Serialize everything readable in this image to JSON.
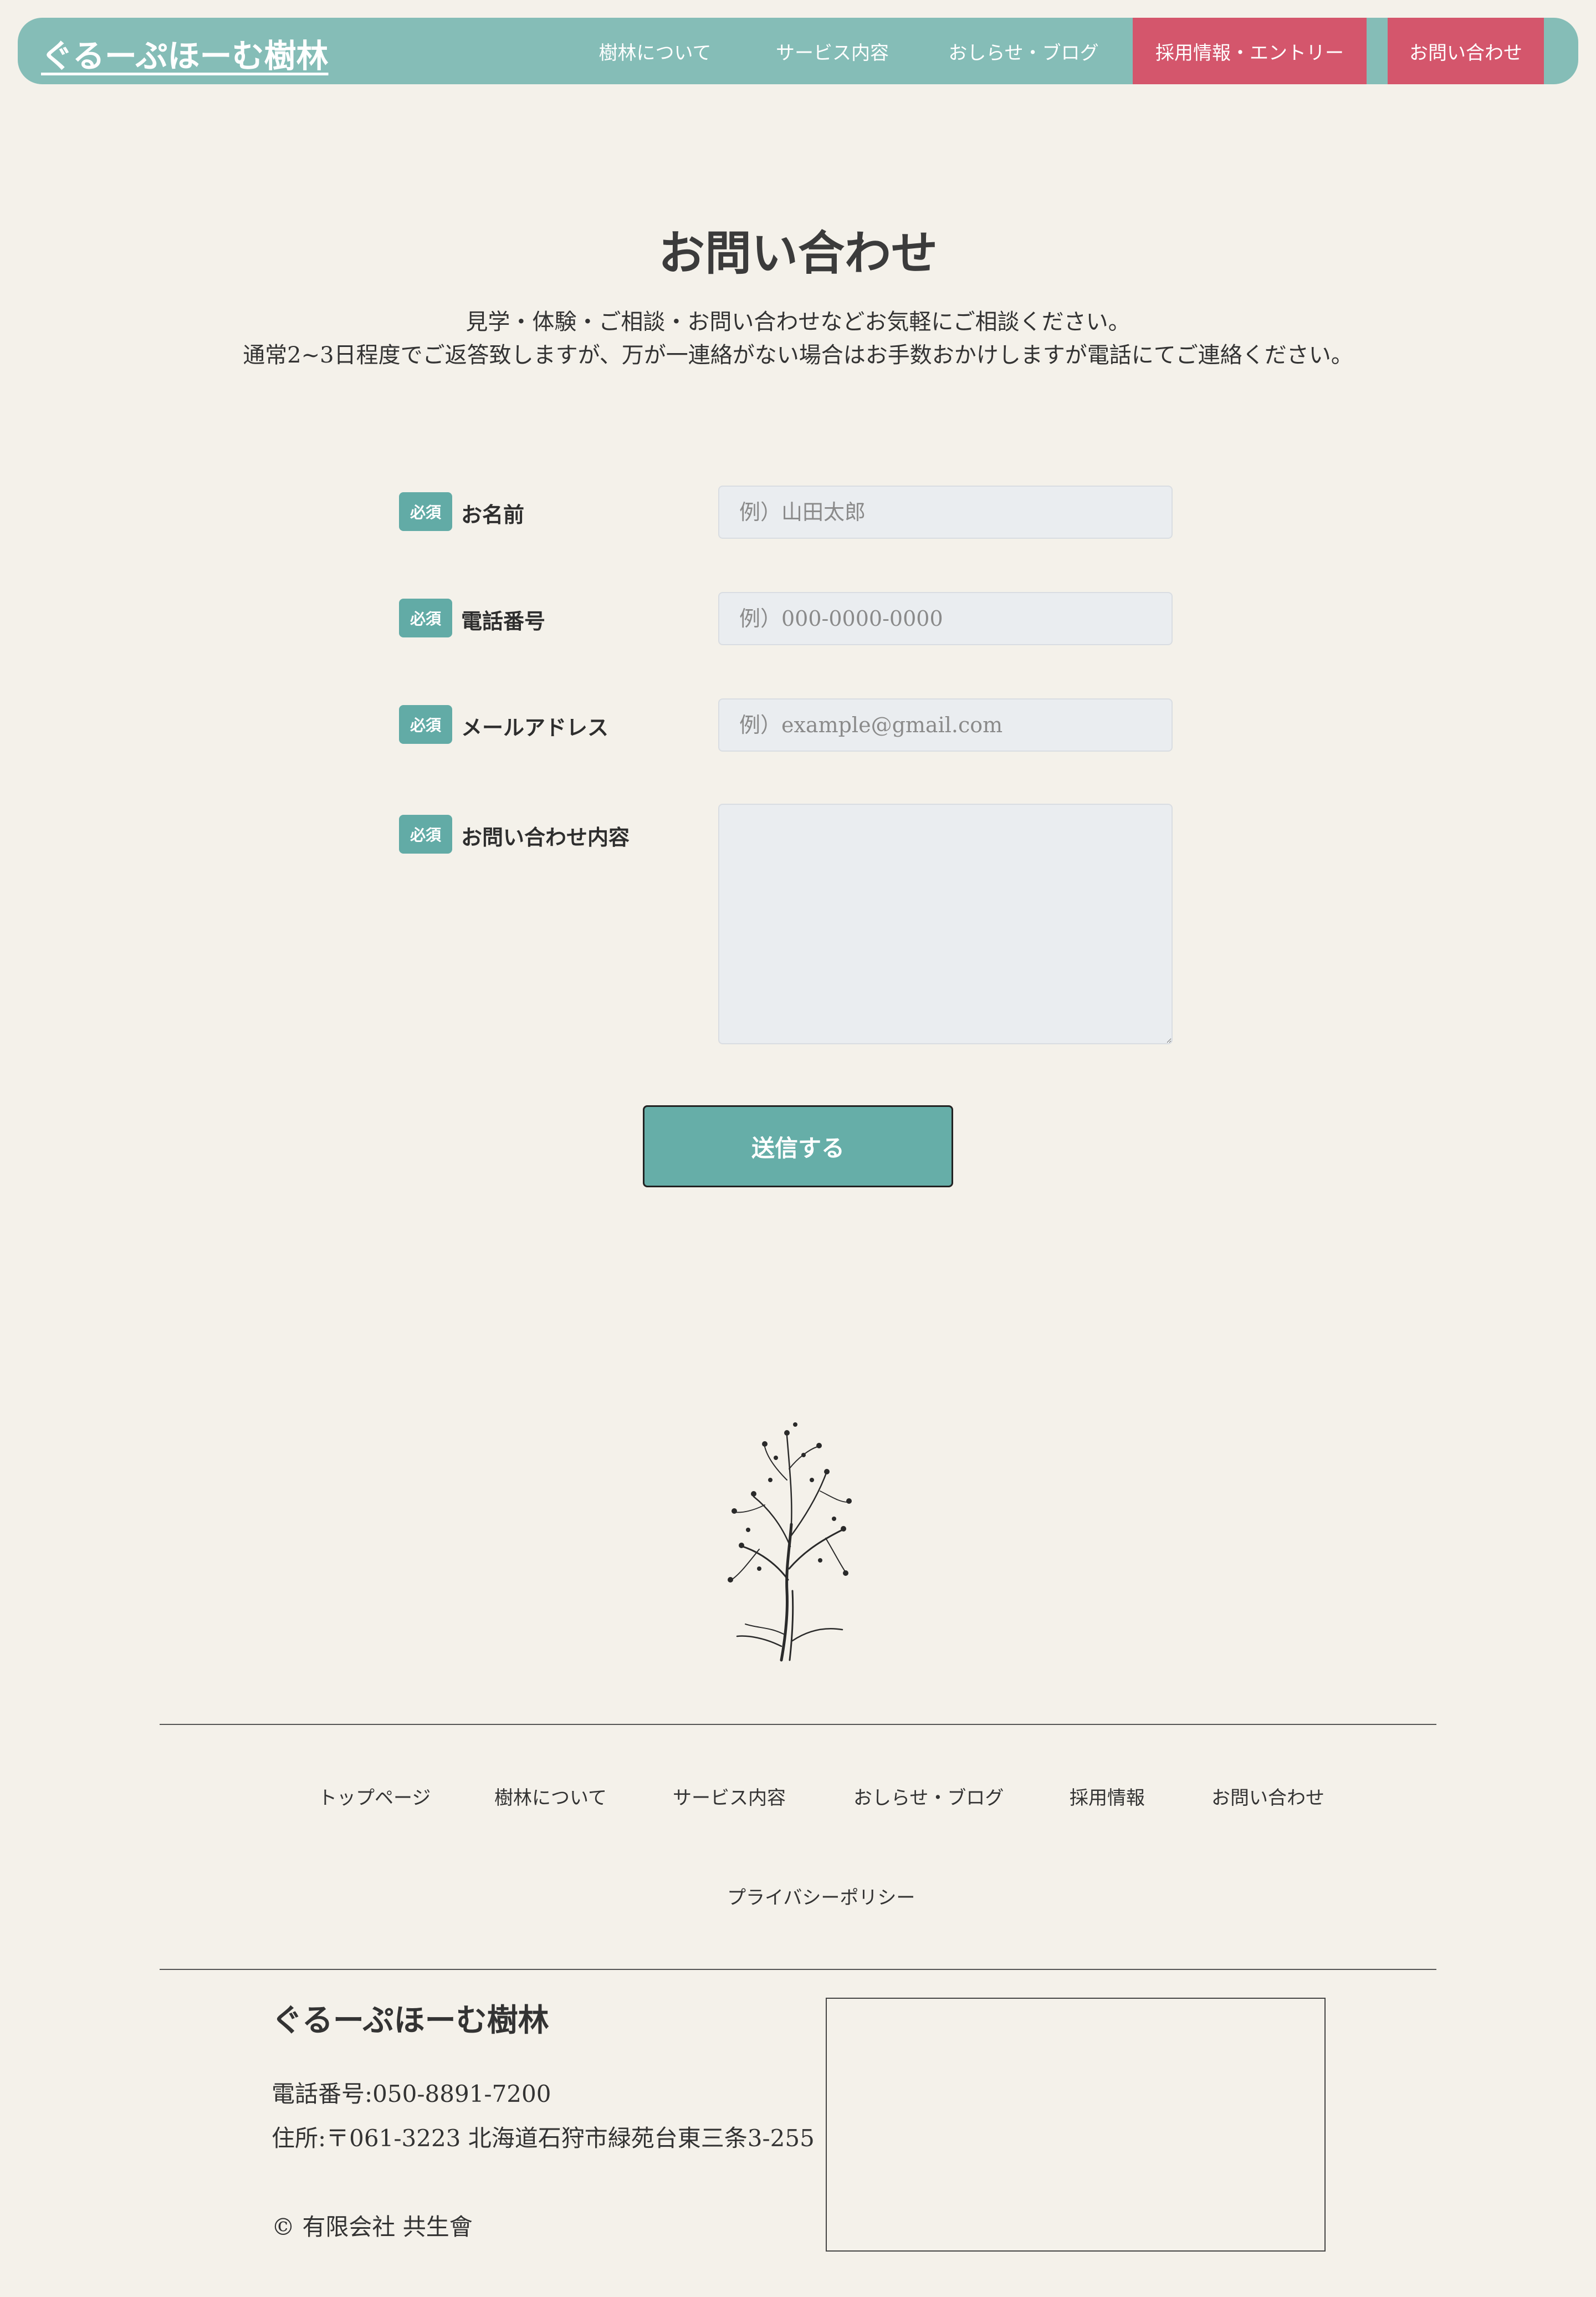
{
  "header": {
    "logo": "ぐるーぷほーむ樹林",
    "nav": [
      {
        "label": "樹林について"
      },
      {
        "label": "サービス内容"
      },
      {
        "label": "おしらせ・ブログ"
      },
      {
        "label": "採用情報・エントリー"
      },
      {
        "label": "お問い合わせ"
      }
    ],
    "accent_color": "#d4566c",
    "header_color": "#85bdb7"
  },
  "main": {
    "title": "お問い合わせ",
    "intro_line1": "見学・体験・ご相談・お問い合わせなどお気軽にご相談ください。",
    "intro_line2": "通常2~3日程度でご返答致しますが、万が一連絡がない場合はお手数おかけしますが電話にてご連絡ください。"
  },
  "form": {
    "required_badge": "必須",
    "fields": [
      {
        "label": "お名前",
        "placeholder": "例）山田太郎",
        "value": ""
      },
      {
        "label": "電話番号",
        "placeholder": "例）000-0000-0000",
        "value": ""
      },
      {
        "label": "メールアドレス",
        "placeholder": "例）example@gmail.com",
        "value": ""
      },
      {
        "label": "お問い合わせ内容",
        "placeholder": "",
        "value": ""
      }
    ],
    "submit_label": "送信する",
    "badge_color": "#62aba6"
  },
  "footer": {
    "links": [
      {
        "label": "トップページ"
      },
      {
        "label": "樹林について"
      },
      {
        "label": "サービス内容"
      },
      {
        "label": "おしらせ・ブログ"
      },
      {
        "label": "採用情報"
      },
      {
        "label": "お問い合わせ"
      },
      {
        "label": "プライバシーポリシー"
      }
    ],
    "brand": "ぐるーぷほーむ樹林",
    "phone": "電話番号:050-8891-7200",
    "address": "住所:〒061-3223 北海道石狩市緑苑台東三条3-255",
    "copyright": "© 有限会社 共生會",
    "tree_icon": "tree-illustration"
  }
}
